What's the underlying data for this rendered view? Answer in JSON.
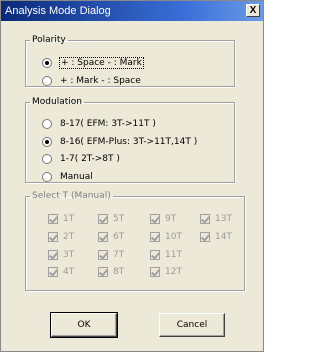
{
  "window": {
    "title": "Analysis Mode Dialog",
    "close_glyph": "X"
  },
  "polarity": {
    "legend": "Polarity",
    "options": [
      {
        "label": "+ : Space  - : Mark",
        "checked": true
      },
      {
        "label": "+ : Mark  - : Space",
        "checked": false
      }
    ]
  },
  "modulation": {
    "legend": "Modulation",
    "options": [
      {
        "label": "8-17( EFM: 3T->11T )",
        "checked": false
      },
      {
        "label": "8-16( EFM-Plus: 3T->11T,14T )",
        "checked": true
      },
      {
        "label": "1-7( 2T->8T )",
        "checked": false
      },
      {
        "label": "Manual",
        "checked": false
      }
    ]
  },
  "select_t": {
    "legend": "Select T (Manual)",
    "items": [
      "1T",
      "2T",
      "3T",
      "4T",
      "5T",
      "6T",
      "7T",
      "8T",
      "9T",
      "10T",
      "11T",
      "12T",
      "13T",
      "14T"
    ]
  },
  "buttons": {
    "ok": "OK",
    "cancel": "Cancel"
  }
}
